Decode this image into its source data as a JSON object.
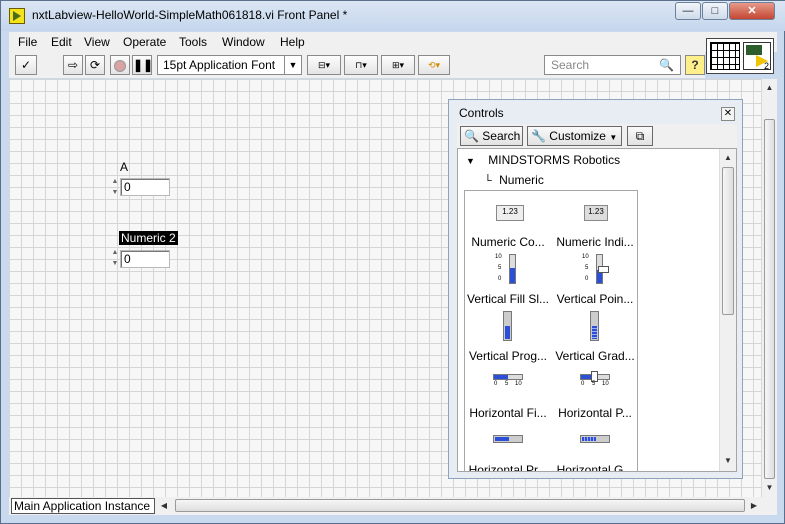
{
  "window": {
    "title": "nxtLabview-HelloWorld-SimpleMath061818.vi Front Panel *",
    "minimize": "—",
    "maximize": "□",
    "close": "✕"
  },
  "menu": [
    "File",
    "Edit",
    "View",
    "Operate",
    "Tools",
    "Window",
    "Help"
  ],
  "toolbar": {
    "font": "15pt Application Font",
    "search_placeholder": "Search",
    "help": "?"
  },
  "front_panel": {
    "controls": [
      {
        "label": "A",
        "value": "0"
      },
      {
        "label": "Numeric 2",
        "value": "0"
      }
    ],
    "connector_terminal": "2"
  },
  "status": {
    "instance": "Main Application Instance"
  },
  "palette": {
    "title": "Controls",
    "search_btn": "Search",
    "customize_btn": "Customize",
    "category": "MINDSTORMS Robotics",
    "subcategory": "Numeric",
    "items": [
      {
        "label": "Numeric Co...",
        "icon": "numeric-control-icon",
        "glyph": "1.23"
      },
      {
        "label": "Numeric Indi...",
        "icon": "numeric-indicator-icon",
        "glyph": "1.23"
      },
      {
        "label": "Vertical Fill Sl...",
        "icon": "vertical-fill-slide-icon"
      },
      {
        "label": "Vertical Poin...",
        "icon": "vertical-pointer-slide-icon"
      },
      {
        "label": "Vertical Prog...",
        "icon": "vertical-progress-bar-icon"
      },
      {
        "label": "Vertical Grad...",
        "icon": "vertical-graduated-bar-icon"
      },
      {
        "label": "Horizontal Fi...",
        "icon": "horizontal-fill-slide-icon"
      },
      {
        "label": "Horizontal P...",
        "icon": "horizontal-pointer-slide-icon"
      },
      {
        "label": "Horizontal Pr...",
        "icon": "horizontal-progress-bar-icon"
      },
      {
        "label": "Horizontal G...",
        "icon": "horizontal-graduated-bar-icon"
      }
    ],
    "scale_vertical": [
      "10",
      "5",
      "0"
    ],
    "scale_horizontal": [
      "0",
      "5",
      "10"
    ]
  }
}
